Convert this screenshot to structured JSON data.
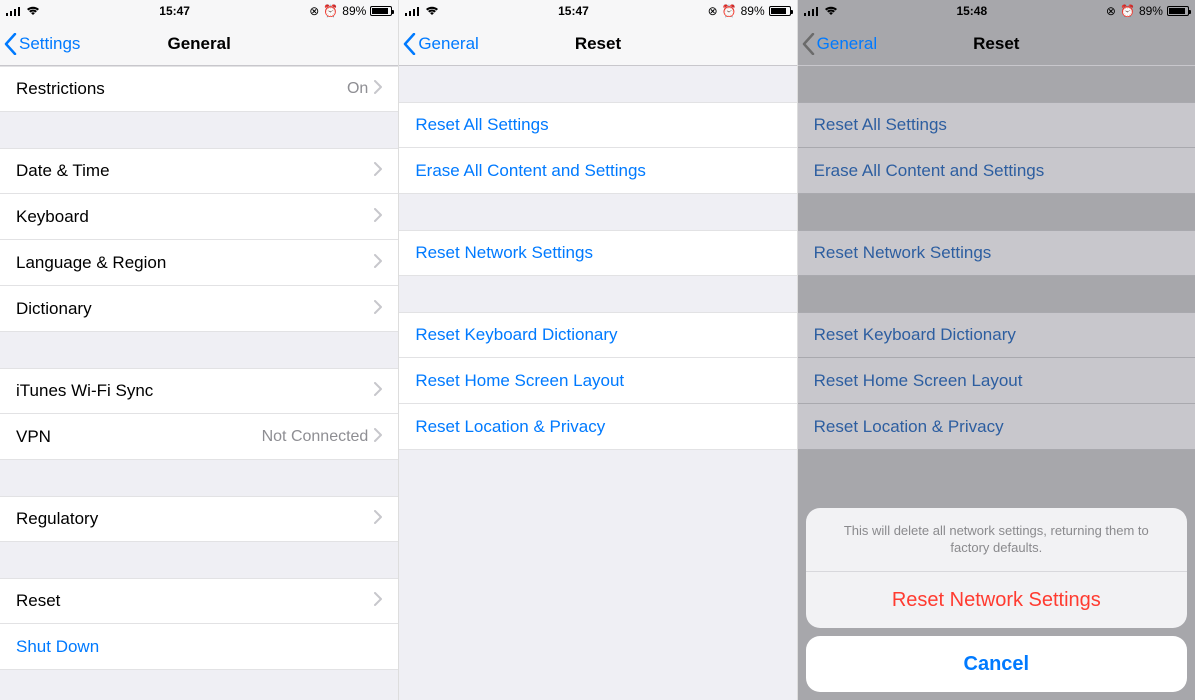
{
  "status": {
    "time1": "15:47",
    "time2": "15:47",
    "time3": "15:48",
    "battery_pct": "89%"
  },
  "screen1": {
    "back_label": "Settings",
    "title": "General",
    "rows": {
      "restrictions": "Restrictions",
      "restrictions_val": "On",
      "date_time": "Date & Time",
      "keyboard": "Keyboard",
      "language_region": "Language & Region",
      "dictionary": "Dictionary",
      "itunes_wifi": "iTunes Wi-Fi Sync",
      "vpn": "VPN",
      "vpn_val": "Not Connected",
      "regulatory": "Regulatory",
      "reset": "Reset",
      "shut_down": "Shut Down"
    }
  },
  "screen2": {
    "back_label": "General",
    "title": "Reset",
    "rows": {
      "reset_all": "Reset All Settings",
      "erase_all": "Erase All Content and Settings",
      "reset_network": "Reset Network Settings",
      "reset_keyboard": "Reset Keyboard Dictionary",
      "reset_home": "Reset Home Screen Layout",
      "reset_location": "Reset Location & Privacy"
    }
  },
  "screen3": {
    "back_label": "General",
    "title": "Reset",
    "sheet_msg": "This will delete all network settings, returning them to factory defaults.",
    "sheet_action": "Reset Network Settings",
    "sheet_cancel": "Cancel"
  }
}
